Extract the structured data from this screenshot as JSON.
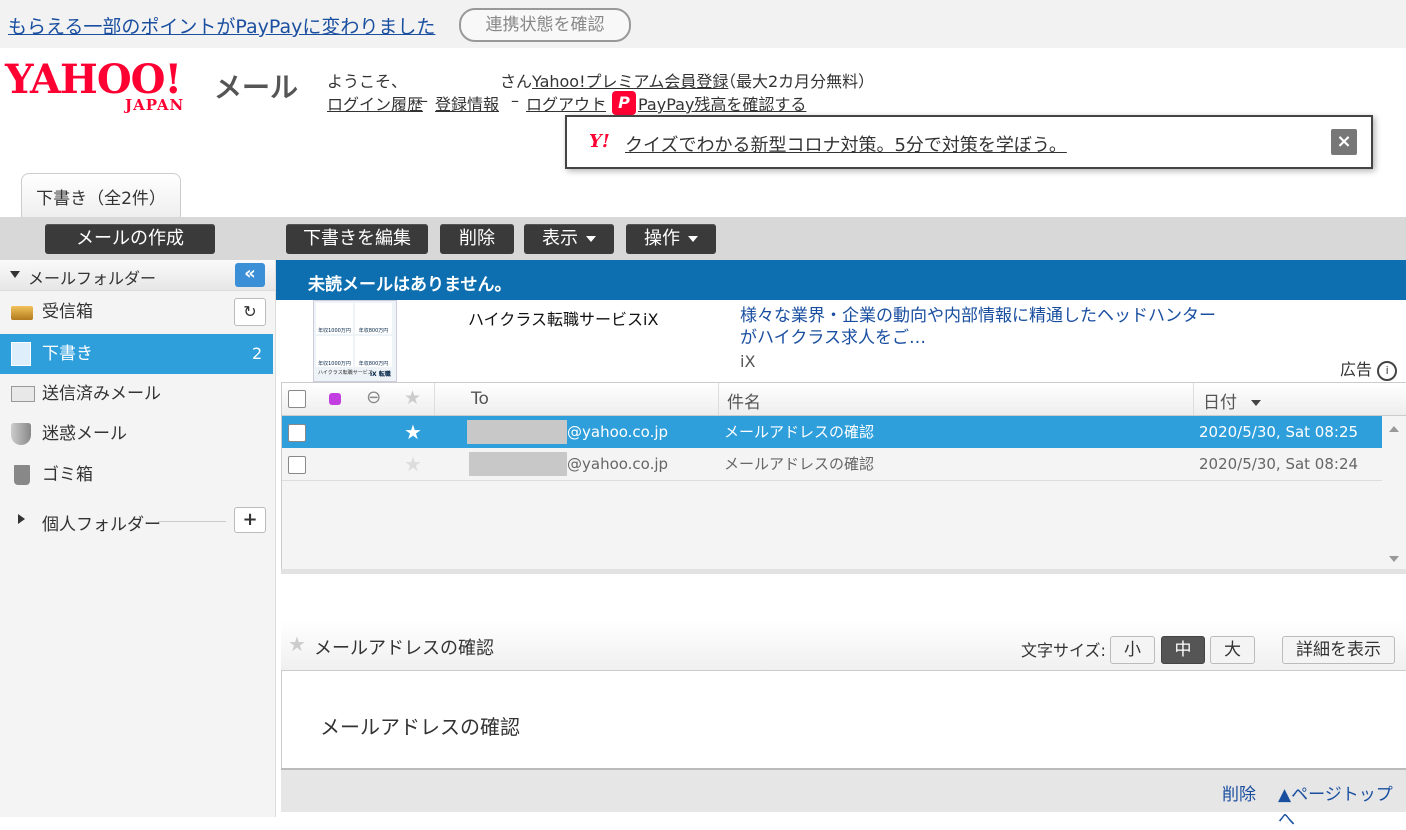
{
  "banner": {
    "link": "もらえる一部のポイントがPayPayに変わりました",
    "button": "連携状態を確認"
  },
  "header": {
    "logo_text": "YAHOO!",
    "logo_sub": "JAPAN",
    "service": "メール",
    "welcome": "ようこそ、",
    "san": "さん",
    "premium_link": "Yahoo!プレミアム会員登録",
    "premium_note": "（最大2カ月分無料）",
    "login_history": "ログイン履歴",
    "registration": "登録情報",
    "logout": "ログアウト",
    "paypay": "PayPay残高を確認する",
    "dash": "–"
  },
  "notice": {
    "y_mark": "Y!",
    "text": "クイズでわかる新型コロナ対策。5分で対策を学ぼう。",
    "close": "×"
  },
  "tab": {
    "label": "下書き（全2件）"
  },
  "toolbar": {
    "compose": "メールの作成",
    "edit_draft": "下書きを編集",
    "delete": "削除",
    "view": "表示",
    "action": "操作"
  },
  "sidebar": {
    "header": "メールフォルダー",
    "items": [
      {
        "label": "受信箱",
        "icon": "inbox-icon"
      },
      {
        "label": "下書き",
        "icon": "draft-icon",
        "count": "2"
      },
      {
        "label": "送信済みメール",
        "icon": "sent-icon"
      },
      {
        "label": "迷惑メール",
        "icon": "spam-shield-icon"
      },
      {
        "label": "ゴミ箱",
        "icon": "trash-icon"
      }
    ],
    "personal": "個人フォルダー"
  },
  "status_bar": {
    "text": "未読メールはありません。"
  },
  "ad": {
    "title": "ハイクラス転職サービスiX",
    "description": "様々な業界・企業の動向や内部情報に精通したヘッドハンターがハイクラス求人をご…",
    "source": "iX",
    "label": "広告",
    "thumb_lines": [
      "年収1000万円",
      "年収800万円",
      "年収1000万円",
      "年収800万円",
      "ハイクラス転職サービス",
      "iX 転職"
    ]
  },
  "table": {
    "columns": {
      "to": "To",
      "subject": "件名",
      "date": "日付"
    },
    "rows": [
      {
        "to": "@yahoo.co.jp",
        "subject": "メールアドレスの確認",
        "date": "2020/5/30, Sat 08:25",
        "selected": true,
        "starred": true
      },
      {
        "to": "@yahoo.co.jp",
        "subject": "メールアドレスの確認",
        "date": "2020/5/30, Sat 08:24",
        "selected": false,
        "starred": false
      }
    ]
  },
  "preview": {
    "subject": "メールアドレスの確認",
    "font_size_label": "文字サイズ:",
    "sizes": [
      "小",
      "中",
      "大"
    ],
    "active_size": "中",
    "details_button": "詳細を表示",
    "body": "メールアドレスの確認",
    "footer_delete": "削除",
    "footer_top": "▲ページトップへ"
  },
  "colors": {
    "accent_blue": "#2f9fdc",
    "status_bar": "#0d6fb0",
    "yahoo_red": "#ff0033",
    "dark_button": "#3a3a3a"
  }
}
